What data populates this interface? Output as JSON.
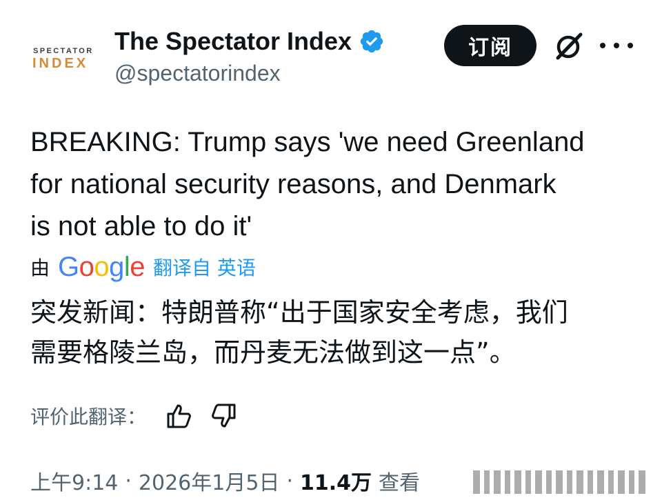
{
  "author": {
    "avatar_line1": "SPECTATOR",
    "avatar_line2": "INDEX",
    "display_name": "The Spectator Index",
    "handle": "@spectatorindex",
    "verified_icon": "verified-badge-icon"
  },
  "header_actions": {
    "subscribe_label": "订阅",
    "grok_icon": "grok-icon",
    "more_icon": "more-icon"
  },
  "tweet": {
    "lines": [
      "BREAKING: Trump says 'we need Greenland",
      "for national security reasons, and Denmark",
      "is not able to do it'"
    ]
  },
  "translation": {
    "by_label": "由",
    "provider": "Google",
    "translated_from": "翻译自 英语",
    "lines": [
      "突发新闻：特朗普称“出于国家安全考虑，我们",
      "需要格陵兰岛，而丹麦无法做到这一点”。"
    ],
    "rate_label": "评价此翻译：",
    "thumbs_up_icon": "thumbs-up-icon",
    "thumbs_down_icon": "thumbs-down-icon"
  },
  "meta": {
    "time": "上午9:14",
    "separator": "·",
    "date": "2026年1月5日",
    "views_count": "11.4万",
    "views_label": "查看"
  },
  "colors": {
    "text_primary": "#0f1419",
    "text_secondary": "#536471",
    "link": "#1d9bf0",
    "verified": "#1d9bf0",
    "avatar_accent": "#d58a3a",
    "button_bg": "#0f1419"
  }
}
